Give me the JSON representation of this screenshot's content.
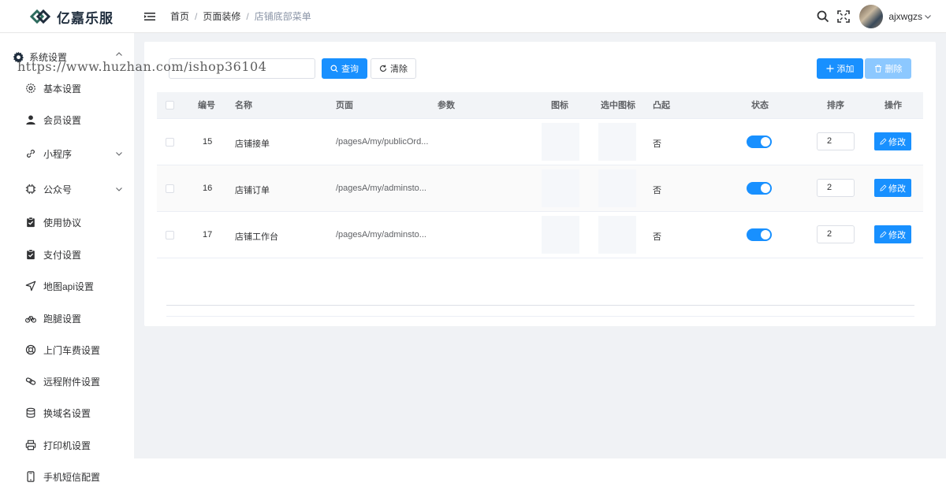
{
  "header": {
    "logo_text": "亿嘉乐服",
    "breadcrumb": [
      "首页",
      "页面装修",
      "店铺底部菜单"
    ],
    "username": "ajxwgzs"
  },
  "watermark": "https://www.huzhan.com/ishop36104",
  "sidebar": {
    "group_label": "系统设置",
    "items": [
      {
        "label": "基本设置",
        "icon": "gear-outline-icon"
      },
      {
        "label": "会员设置",
        "icon": "user-icon"
      },
      {
        "label": "小程序",
        "icon": "link-icon",
        "has_children": true
      },
      {
        "label": "公众号",
        "icon": "chip-icon",
        "has_children": true
      },
      {
        "label": "使用协议",
        "icon": "clipboard-check-icon"
      },
      {
        "label": "支付设置",
        "icon": "clipboard-check-icon"
      },
      {
        "label": "地图api设置",
        "icon": "navigation-icon"
      },
      {
        "label": "跑腿设置",
        "icon": "bicycle-icon"
      },
      {
        "label": "上门车费设置",
        "icon": "lifebuoy-icon"
      },
      {
        "label": "远程附件设置",
        "icon": "link-chain-icon"
      },
      {
        "label": "换域名设置",
        "icon": "database-icon"
      },
      {
        "label": "打印机设置",
        "icon": "printer-icon"
      },
      {
        "label": "手机短信配置",
        "icon": "mobile-icon"
      }
    ]
  },
  "toolbar": {
    "search_placeholder": "",
    "query_label": "查询",
    "clear_label": "清除",
    "add_label": "添加",
    "delete_label": "删除"
  },
  "table": {
    "columns": [
      "编号",
      "名称",
      "页面",
      "参数",
      "图标",
      "选中图标",
      "凸起",
      "状态",
      "排序",
      "操作"
    ],
    "rows": [
      {
        "id": "15",
        "name": "店铺接单",
        "page": "/pagesA/my/publicOrd...",
        "param": "",
        "raised": "否",
        "status": true,
        "sort": "2",
        "action": "修改"
      },
      {
        "id": "16",
        "name": "店铺订单",
        "page": "/pagesA/my/adminsto...",
        "param": "",
        "raised": "否",
        "status": true,
        "sort": "2",
        "action": "修改"
      },
      {
        "id": "17",
        "name": "店铺工作台",
        "page": "/pagesA/my/adminsto...",
        "param": "",
        "raised": "否",
        "status": true,
        "sort": "2",
        "action": "修改"
      }
    ]
  },
  "colors": {
    "primary": "#1890ff",
    "primary_disabled": "#8cc8ff",
    "page_bg": "#f0f2f5",
    "table_header_bg": "#f2f4f7"
  }
}
